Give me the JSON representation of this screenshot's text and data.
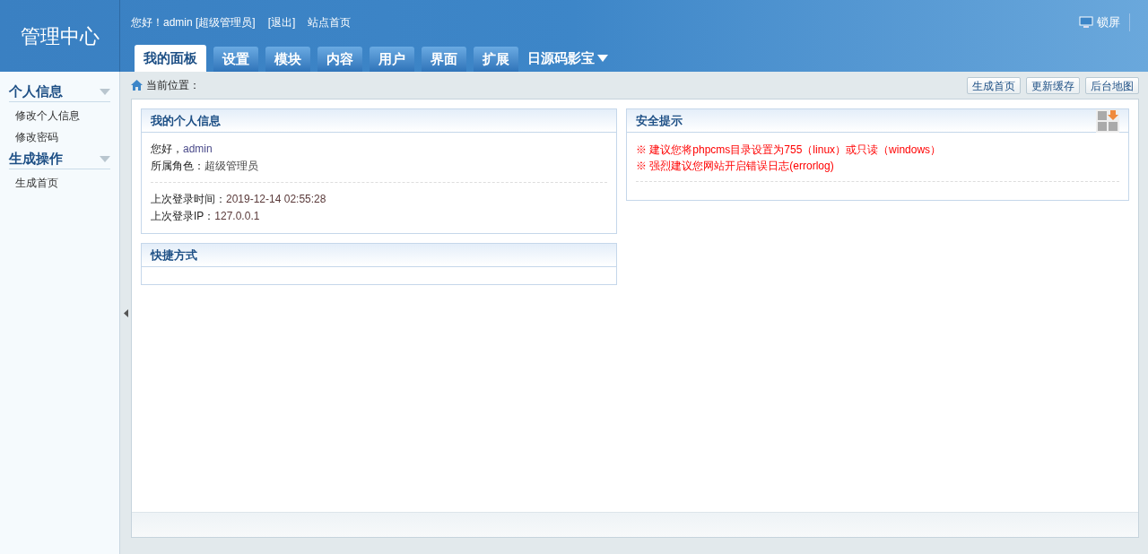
{
  "logo": "管理中心",
  "header": {
    "greeting": "您好！admin [超级管理员]",
    "logout": "[退出]",
    "site_home": "站点首页",
    "lock": "锁屏"
  },
  "tabs": [
    {
      "label": "我的面板",
      "selected": true
    },
    {
      "label": "设置",
      "selected": false
    },
    {
      "label": "模块",
      "selected": false
    },
    {
      "label": "内容",
      "selected": false
    },
    {
      "label": "用户",
      "selected": false
    },
    {
      "label": "界面",
      "selected": false
    },
    {
      "label": "扩展",
      "selected": false
    }
  ],
  "tab_dropdown": "日源码影宝",
  "sidebar": [
    {
      "title": "个人信息",
      "expanded": true,
      "items": [
        "修改个人信息",
        "修改密码"
      ]
    },
    {
      "title": "生成操作",
      "expanded": true,
      "items": [
        "生成首页"
      ]
    }
  ],
  "breadcrumb": "当前位置：",
  "actions": [
    "生成首页",
    "更新缓存",
    "后台地图"
  ],
  "profile": {
    "title": "我的个人信息",
    "rows": [
      {
        "label": "您好，",
        "value": "admin"
      },
      {
        "label": "所属角色：",
        "value": "超级管理员"
      }
    ],
    "login_rows": [
      {
        "label": "上次登录时间：",
        "value": "2019-12-14 02:55:28"
      },
      {
        "label": "上次登录IP：",
        "value": "127.0.0.1"
      }
    ]
  },
  "shortcuts": {
    "title": "快捷方式"
  },
  "security": {
    "title": "安全提示",
    "tips": [
      "※ 建议您将phpcms目录设置为755（linux）或只读（windows）",
      "※ 强烈建议您网站开启错误日志(errorlog)"
    ]
  }
}
